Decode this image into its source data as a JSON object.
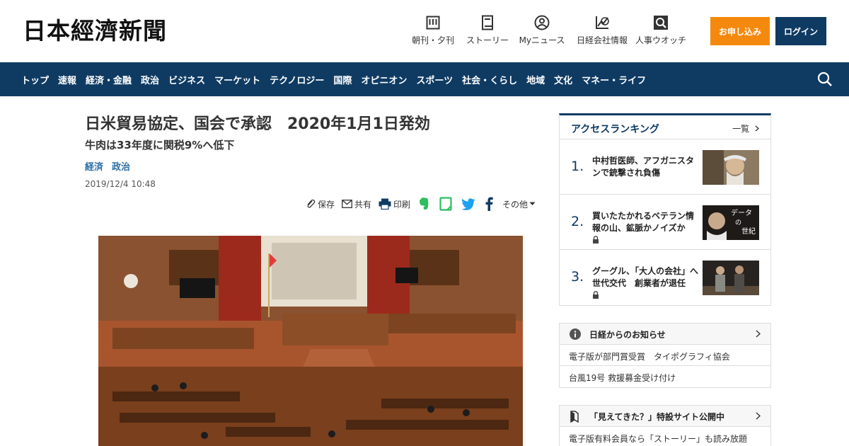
{
  "header": {
    "logo": "日本經濟新聞",
    "tools": [
      {
        "label": "朝刊・夕刊",
        "icon": "newspaper-icon"
      },
      {
        "label": "ストーリー",
        "icon": "book-icon"
      },
      {
        "label": "Myニュース",
        "icon": "person-icon"
      },
      {
        "label": "日経会社情報",
        "icon": "chart-icon"
      },
      {
        "label": "人事ウオッチ",
        "icon": "magnifier-icon"
      }
    ],
    "apply_label": "お申し込み",
    "login_label": "ログイン"
  },
  "nav": {
    "items": [
      "トップ",
      "速報",
      "経済・金融",
      "政治",
      "ビジネス",
      "マーケット",
      "テクノロジー",
      "国際",
      "オピニオン",
      "スポーツ",
      "社会・くらし",
      "地域",
      "文化",
      "マネー・ライフ"
    ]
  },
  "article": {
    "headline": "日米貿易協定、国会で承認　2020年1月1日発効",
    "subhead": "牛肉は33年度に関税9%へ低下",
    "tags": [
      "経済",
      "政治"
    ],
    "date": "2019/12/4 10:48",
    "share": {
      "save": "保存",
      "share": "共有",
      "print": "印刷",
      "other": "その他"
    }
  },
  "ranking": {
    "title": "アクセスランキング",
    "more": "一覧",
    "items": [
      {
        "rank": "1.",
        "text": "中村哲医師、アフガニスタンで銃撃され負傷",
        "locked": false
      },
      {
        "rank": "2.",
        "text": "買いたたかれるベテラン情報の山、鉱脈かノイズか",
        "locked": true
      },
      {
        "rank": "3.",
        "text": "グーグル、「大人の会社」へ世代交代　創業者が退任",
        "locked": true
      }
    ],
    "thumb2_text": [
      "データ",
      "の",
      "世紀"
    ]
  },
  "notice": {
    "title": "日経からのお知らせ",
    "items": [
      "電子版が部門賞受賞　タイポグラフィ協会",
      "台風19号 救援募金受け付け"
    ]
  },
  "notice2": {
    "title": "「見えてきた？」特設サイト公開中",
    "items": [
      "電子版有料会員なら「ストーリー」も読み放題"
    ]
  },
  "colors": {
    "navy": "#0f3b63",
    "orange": "#f5890d",
    "link": "#2a6fa8"
  }
}
